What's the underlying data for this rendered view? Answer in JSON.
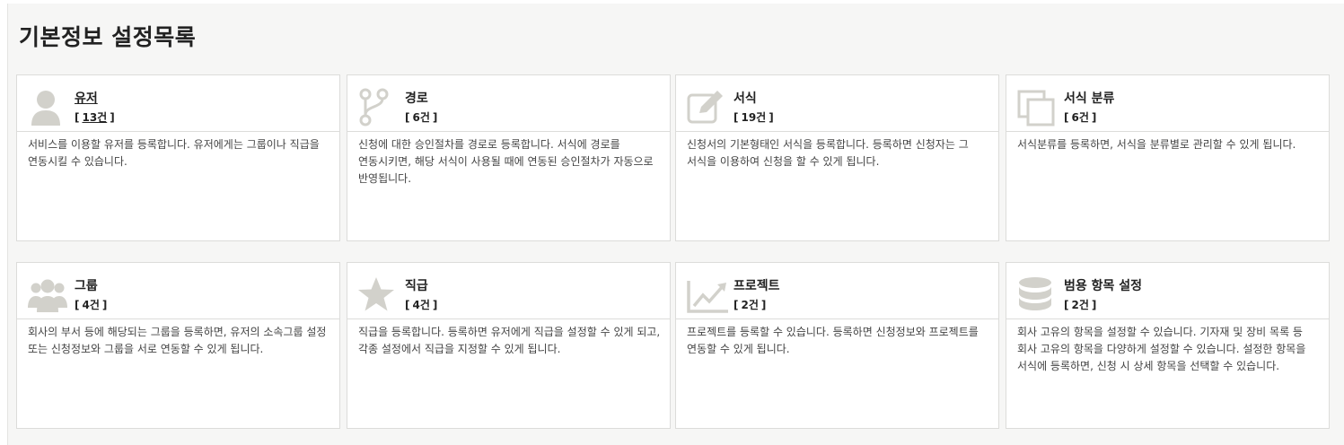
{
  "page": {
    "title": "기본정보 설정목록"
  },
  "colors": {
    "icon": "#d2d1cb",
    "border": "#dcdcda",
    "panel": "#f6f6f5"
  },
  "cards": [
    {
      "title": "유저",
      "count_open": "[",
      "count": "13건",
      "count_close": "]",
      "icon": "user-icon",
      "desc": "서비스를 이용할 유저를 등록합니다. 유저에게는 그룹이나 직급을 연동시킬 수 있습니다."
    },
    {
      "title": "경로",
      "count_open": "[",
      "count": "6건",
      "count_close": "]",
      "icon": "route-icon",
      "desc": "신청에 대한 승인절차를 경로로 등록합니다. 서식에 경로를 연동시키면, 해당 서식이 사용될 때에 연동된 승인절차가 자동으로 반영됩니다."
    },
    {
      "title": "서식",
      "count_open": "[",
      "count": "19건",
      "count_close": "]",
      "icon": "form-edit-icon",
      "desc": "신청서의 기본형태인 서식을 등록합니다. 등록하면 신청자는 그 서식을 이용하여 신청을 할 수 있게 됩니다."
    },
    {
      "title": "서식 분류",
      "count_open": "[",
      "count": "6건",
      "count_close": "]",
      "icon": "copy-icon",
      "desc": "서식분류를 등록하면, 서식을 분류별로 관리할 수 있게 됩니다."
    },
    {
      "title": "그룹",
      "count_open": "[",
      "count": "4건",
      "count_close": "]",
      "icon": "group-icon",
      "desc": "회사의 부서 등에 해당되는 그룹을 등록하면, 유저의 소속그룹 설정 또는 신청정보와 그룹을 서로 연동할 수 있게 됩니다."
    },
    {
      "title": "직급",
      "count_open": "[",
      "count": "4건",
      "count_close": "]",
      "icon": "star-icon",
      "desc": "직급을 등록합니다. 등록하면 유저에게 직급을 설정할 수 있게 되고, 각종 설정에서 직급을 지정할 수 있게 됩니다."
    },
    {
      "title": "프로젝트",
      "count_open": "[",
      "count": "2건",
      "count_close": "]",
      "icon": "chart-line-icon",
      "desc": "프로젝트를 등록할 수 있습니다. 등록하면 신청정보와 프로젝트를 연동할 수 있게 됩니다."
    },
    {
      "title": "범용 항목 설정",
      "count_open": "[",
      "count": "2건",
      "count_close": "]",
      "icon": "database-icon",
      "desc": "회사 고유의 항목을 설정할 수 있습니다. 기자재 및 장비 목록 등 회사 고유의 항목을 다양하게 설정할 수 있습니다. 설정한 항목을 서식에 등록하면, 신청 시 상세 항목을 선택할 수 있습니다."
    }
  ]
}
